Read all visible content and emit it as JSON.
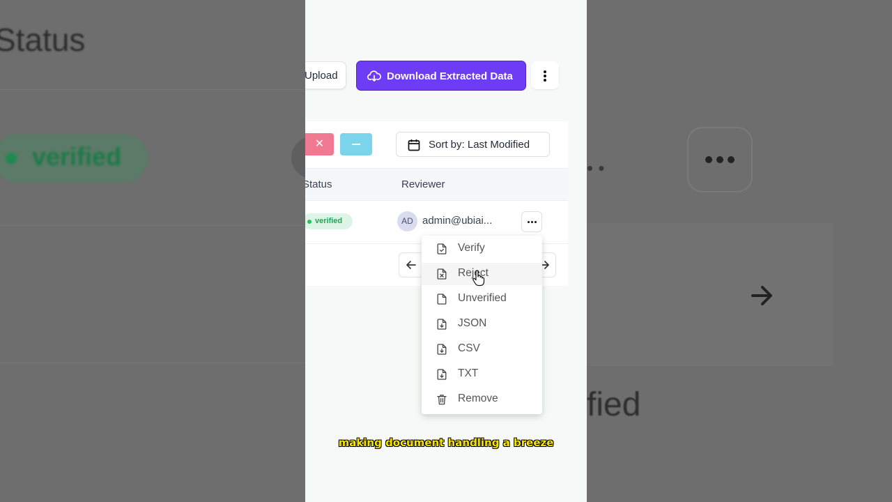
{
  "background": {
    "status_heading": "Status",
    "verified_badge": "verified",
    "partial_text": "fied"
  },
  "toolbar": {
    "upload_label": "Upload",
    "download_label": "Download Extracted Data"
  },
  "filters": {
    "reject_symbol": "✕",
    "sort_label": "Sort by: Last Modified"
  },
  "table": {
    "columns": [
      "Status",
      "Reviewer"
    ],
    "rows": [
      {
        "status": "verified",
        "reviewer_initials": "AD",
        "reviewer": "admin@ubiai..."
      }
    ]
  },
  "context_menu": {
    "items": [
      {
        "label": "Verify",
        "icon": "file-check-icon"
      },
      {
        "label": "Reject",
        "icon": "file-x-icon"
      },
      {
        "label": "Unverified",
        "icon": "file-icon"
      },
      {
        "label": "JSON",
        "icon": "file-download-icon"
      },
      {
        "label": "CSV",
        "icon": "file-download-icon"
      },
      {
        "label": "TXT",
        "icon": "file-download-icon"
      },
      {
        "label": "Remove",
        "icon": "trash-icon"
      }
    ],
    "hovered": "Reject"
  },
  "caption": "making document handling a breeze",
  "colors": {
    "primary": "#6d3cf4",
    "reject": "#f07891",
    "neutral": "#7ad5ea",
    "verified_bg": "#dcf5e7",
    "verified_text": "#22a35a",
    "caption": "#f7e600"
  }
}
